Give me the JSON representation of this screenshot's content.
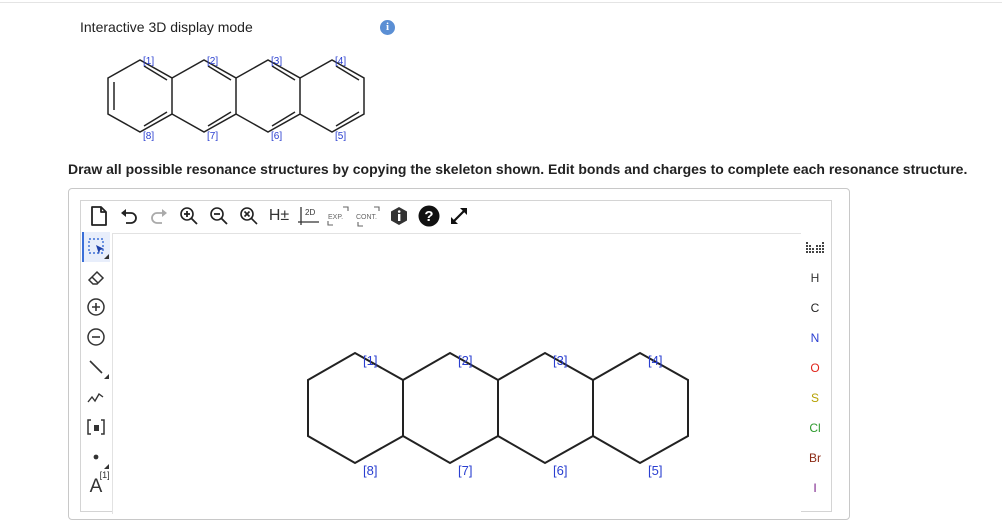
{
  "header": {
    "mode_title": "Interactive 3D display mode",
    "info_icon": "i"
  },
  "preview": {
    "labels": [
      "[1]",
      "[2]",
      "[3]",
      "[4]",
      "[8]",
      "[7]",
      "[6]",
      "[5]"
    ]
  },
  "instruction": "Draw all possible resonance structures by copying the skeleton shown. Edit bonds and charges to complete each resonance structure.",
  "toolbar": {
    "items": [
      "new-document",
      "undo",
      "redo",
      "zoom-in",
      "zoom-out",
      "zoom-reset",
      "hydrogens",
      "2d-clean",
      "expand",
      "contract",
      "info",
      "help",
      "fullscreen"
    ],
    "h_label": "H±",
    "clean_label": "2D",
    "expand_label": "EXP.",
    "contract_label": "CONT."
  },
  "left_tools": [
    "select-lasso",
    "eraser",
    "charge-plus",
    "charge-minus",
    "single-bond",
    "chain",
    "bracket",
    "atom-dot",
    "atom-label"
  ],
  "left_tool_text": {
    "atom_label": "A",
    "atom_label_sup": "[1]"
  },
  "right_tools": {
    "periodic_table": "periodic-table-icon",
    "elements": [
      {
        "symbol": "H",
        "color": "#333333"
      },
      {
        "symbol": "C",
        "color": "#222222"
      },
      {
        "symbol": "N",
        "color": "#2b3fd1"
      },
      {
        "symbol": "O",
        "color": "#e0251b"
      },
      {
        "symbol": "S",
        "color": "#b5a100"
      },
      {
        "symbol": "Cl",
        "color": "#2e9a2e"
      },
      {
        "symbol": "Br",
        "color": "#8b2a14"
      },
      {
        "symbol": "I",
        "color": "#7a1f8a"
      }
    ]
  },
  "skeleton": {
    "labels": [
      "[1]",
      "[2]",
      "[3]",
      "[4]",
      "[8]",
      "[7]",
      "[6]",
      "[5]"
    ]
  },
  "colors": {
    "label_blue": "#2a3fd0",
    "accent_blue": "#3b6fd8",
    "info_blue": "#5b8fd4"
  }
}
